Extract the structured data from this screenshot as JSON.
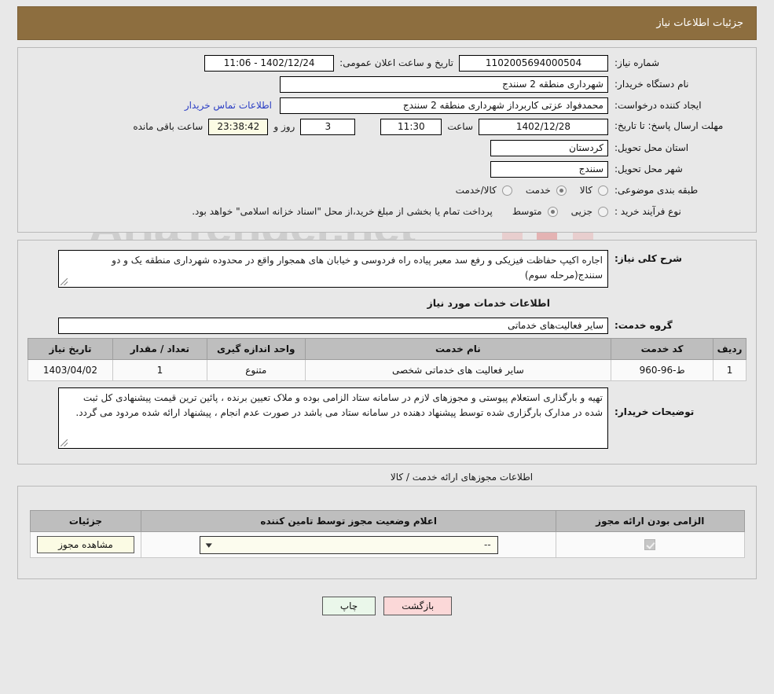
{
  "header": {
    "title": "جزئیات اطلاعات نیاز"
  },
  "form": {
    "need_number_label": "شماره نیاز:",
    "need_number_value": "1102005694000504",
    "announce_label": "تاریخ و ساعت اعلان عمومی:",
    "announce_value": "1402/12/24 - 11:06",
    "buyer_org_label": "نام دستگاه خریدار:",
    "buyer_org_value": "شهرداری منطقه 2 سنندج",
    "creator_label": "ایجاد کننده درخواست:",
    "creator_value": "محمدفواد عزتی کاربرداز شهرداری منطقه 2 سنندج",
    "contact_link": "اطلاعات تماس خریدار",
    "deadline_label": "مهلت ارسال پاسخ: تا تاریخ:",
    "deadline_date": "1402/12/28",
    "time_label": "ساعت",
    "deadline_time": "11:30",
    "days_value": "3",
    "days_label": "روز و",
    "countdown": "23:38:42",
    "countdown_label": "ساعت باقی مانده",
    "province_label": "استان محل تحویل:",
    "province_value": "کردستان",
    "city_label": "شهر محل تحویل:",
    "city_value": "سنندج",
    "category_label": "طبقه بندی موضوعی:",
    "category_options": [
      {
        "label": "کالا",
        "selected": false
      },
      {
        "label": "خدمت",
        "selected": true
      },
      {
        "label": "کالا/خدمت",
        "selected": false
      }
    ],
    "process_label": "نوع فرآیند خرید :",
    "process_options": [
      {
        "label": "جزیی",
        "selected": false
      },
      {
        "label": "متوسط",
        "selected": true
      }
    ],
    "process_note": "پرداخت تمام یا بخشی از مبلغ خرید،از محل \"اسناد خزانه اسلامی\" خواهد بود."
  },
  "description": {
    "label": "شرح کلی نیاز:",
    "value": "اجاره اکیپ حفاظت فیزیکی و رفع سد معبر پیاده راه فردوسی و خیابان های همجوار واقع در محدوده شهرداری منطقه یک و دو سنندج(مرحله سوم)"
  },
  "services_section": {
    "title": "اطلاعات خدمات مورد نیاز",
    "group_label": "گروه خدمت:",
    "group_value": "سایر فعالیت‌های خدماتی",
    "columns": [
      "ردیف",
      "کد خدمت",
      "نام خدمت",
      "واحد اندازه گیری",
      "تعداد / مقدار",
      "تاریخ نیاز"
    ],
    "rows": [
      {
        "index": "1",
        "code": "ط-96-960",
        "name": "سایر فعالیت های خدماتی شخصی",
        "unit": "متنوع",
        "quantity": "1",
        "date": "1403/04/02"
      }
    ]
  },
  "buyer_notes": {
    "label": "توضیحات خریدار:",
    "value": "تهیه و بارگذاری استعلام پیوستی و مجوزهای لازم در سامانه ستاد الزامی بوده و ملاک تعیین برنده ، پائین ترین قیمت پیشنهادی کل ثبت شده در مدارک بارگزاری شده توسط پیشنهاد دهنده در سامانه ستاد می باشد در صورت عدم انجام ، پیشنهاد ارائه شده مردود می گردد."
  },
  "permits_section": {
    "title": "اطلاعات مجوزهای ارائه خدمت / کالا",
    "columns": [
      "الزامی بودن ارائه مجوز",
      "اعلام وضعیت مجوز توسط تامین کننده",
      "جزئیات"
    ],
    "rows": [
      {
        "required": true,
        "status_value": "--",
        "details_button": "مشاهده مجوز"
      }
    ]
  },
  "footer": {
    "back_label": "بازگشت",
    "print_label": "چاپ"
  },
  "watermark": {
    "text": "AriaTender.net"
  },
  "colors": {
    "header_bar": "#8d6e3f",
    "table_header": "#bebebe",
    "back_button": "#fbd8d8",
    "print_button": "#eaf7ea",
    "link": "#2b3ec4",
    "highlight_field": "#fbfbe4"
  }
}
